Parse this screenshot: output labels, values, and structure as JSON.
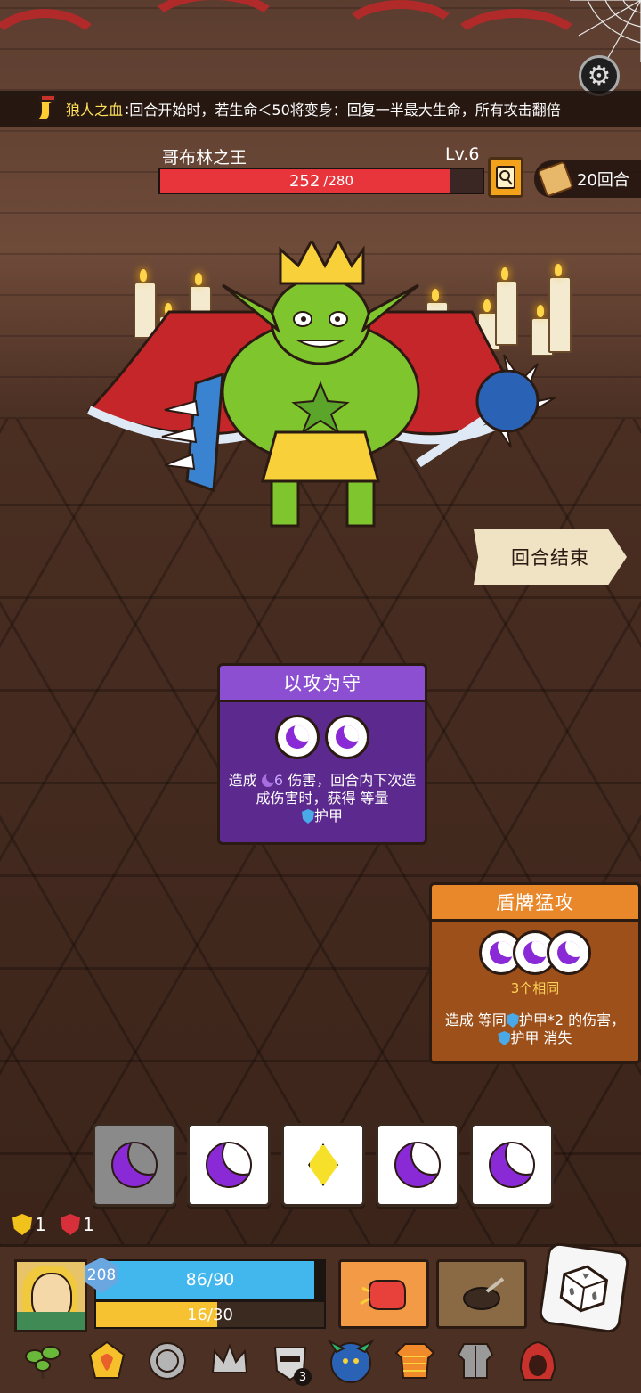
{
  "passive": {
    "name": "狼人之血",
    "separator": ":",
    "description": "回合开始时，若生命＜50将变身：回复一半最大生命，所有攻击翻倍"
  },
  "enemy": {
    "name": "哥布林之王",
    "level": "Lv.6",
    "hp_current": "252",
    "hp_max": "/280",
    "hp_fraction": 0.9
  },
  "turns": "20回合",
  "end_turn_label": "回合结束",
  "cards": [
    {
      "title": "以攻为守",
      "color": "#8d4fd1",
      "slots": 2,
      "desc_pre": "造成",
      "damage": "6",
      "desc_mid": "伤害，回合内下次造成伤害时，获得 等量",
      "desc_post": "护甲"
    },
    {
      "title": "盾牌猛攻",
      "color": "#e8882a",
      "slots": 3,
      "same_label": "3个相同",
      "desc_pre": "造成 等同",
      "desc_mid": "护甲*2 的伤害，",
      "desc_post": "护甲 消失"
    }
  ],
  "dice": [
    {
      "face": "moon-icon",
      "used": true
    },
    {
      "face": "moon-icon",
      "used": false
    },
    {
      "face": "diamond-icon",
      "used": false
    },
    {
      "face": "moon-icon",
      "used": false
    },
    {
      "face": "moon-icon",
      "used": false
    }
  ],
  "status": {
    "shield_count": "1",
    "target_count": "1"
  },
  "player": {
    "armor_badge": "208",
    "armor_value": "86/90",
    "armor_fraction": 0.956,
    "energy_value": "16/30",
    "energy_fraction": 0.533
  },
  "relics": [
    {
      "icon": "leaf-icon"
    },
    {
      "icon": "gem-icon"
    },
    {
      "icon": "coin-icon"
    },
    {
      "icon": "crown-icon"
    },
    {
      "icon": "mask-icon",
      "count": "3"
    },
    {
      "icon": "dragon-icon"
    },
    {
      "icon": "sweater-icon"
    },
    {
      "icon": "armor-icon"
    },
    {
      "icon": "hood-icon"
    }
  ],
  "colors": {
    "hp": "#e8343b",
    "armor": "#41b7ee",
    "energy": "#f6c232",
    "moon": "#8a2ad6"
  }
}
